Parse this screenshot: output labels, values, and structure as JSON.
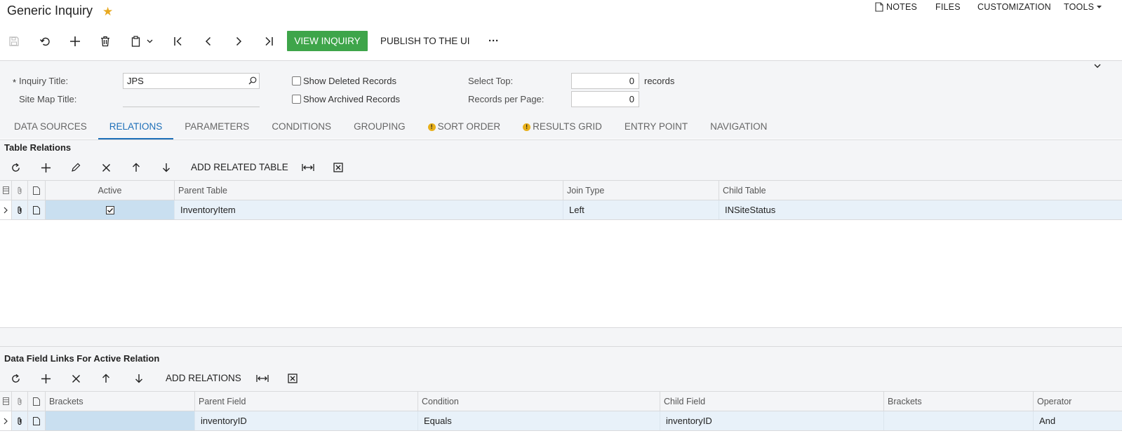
{
  "header": {
    "title": "Generic Inquiry",
    "nav": {
      "notes": "NOTES",
      "files": "FILES",
      "customization": "CUSTOMIZATION",
      "tools": "TOOLS"
    }
  },
  "toolbar": {
    "view_inquiry": "VIEW INQUIRY",
    "publish": "PUBLISH TO THE UI",
    "more": "···"
  },
  "form": {
    "required_mark": "*",
    "inquiry_title_label": "Inquiry Title:",
    "inquiry_title_value": "JPS",
    "site_map_title_label": "Site Map Title:",
    "site_map_title_value": "",
    "show_deleted_label": "Show Deleted Records",
    "show_archived_label": "Show Archived Records",
    "select_top_label": "Select Top:",
    "select_top_value": "0",
    "records_suffix": "records",
    "records_per_page_label": "Records per Page:",
    "records_per_page_value": "0"
  },
  "tabs": [
    {
      "label": "DATA SOURCES"
    },
    {
      "label": "RELATIONS"
    },
    {
      "label": "PARAMETERS"
    },
    {
      "label": "CONDITIONS"
    },
    {
      "label": "GROUPING"
    },
    {
      "label": "SORT ORDER"
    },
    {
      "label": "RESULTS GRID"
    },
    {
      "label": "ENTRY POINT"
    },
    {
      "label": "NAVIGATION"
    }
  ],
  "warning_mark": "!",
  "relations": {
    "title": "Table Relations",
    "add_button": "ADD RELATED TABLE",
    "columns": {
      "active": "Active",
      "parent_table": "Parent Table",
      "join_type": "Join Type",
      "child_table": "Child Table"
    },
    "rows": [
      {
        "parent_table": "InventoryItem",
        "join_type": "Left",
        "child_table": "INSiteStatus"
      }
    ]
  },
  "links": {
    "title": "Data Field Links For Active Relation",
    "add_button": "ADD RELATIONS",
    "columns": {
      "brackets_open": "Brackets",
      "parent_field": "Parent Field",
      "condition": "Condition",
      "child_field": "Child Field",
      "brackets_close": "Brackets",
      "operator": "Operator"
    },
    "rows": [
      {
        "brackets_open": "",
        "parent_field": "inventoryID",
        "condition": "Equals",
        "child_field": "inventoryID",
        "brackets_close": "",
        "operator": "And"
      }
    ]
  },
  "colors": {
    "accent": "#1d6fb8",
    "primary_button": "#3ea54a",
    "star": "#e8a920",
    "selected_row": "#e8f1f9"
  }
}
